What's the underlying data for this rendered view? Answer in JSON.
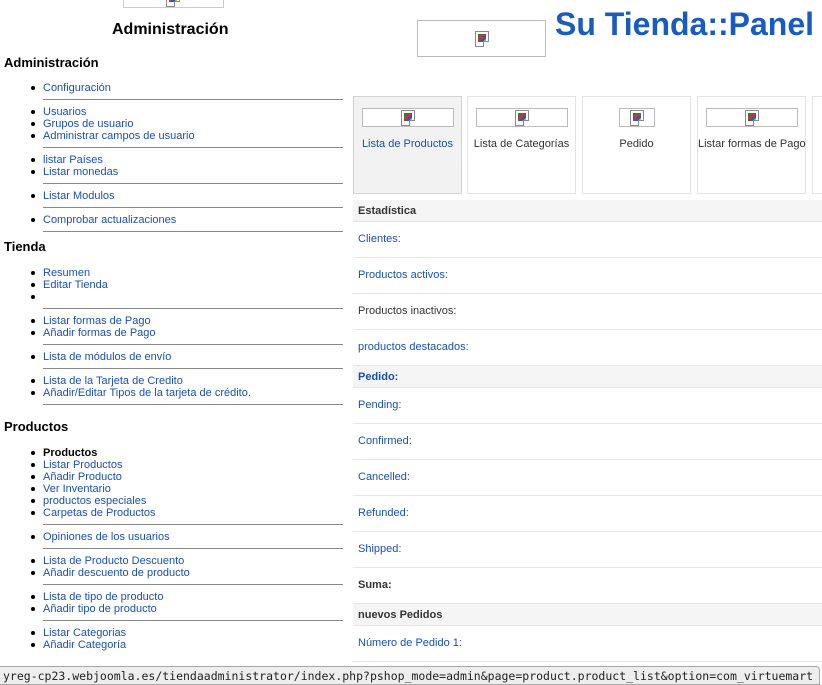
{
  "header": {
    "admin_title": "Administración",
    "panel_title": "Su Tienda::Panel"
  },
  "sidebar": {
    "sections": [
      {
        "title": "Administración"
      },
      {
        "title": "Tienda"
      },
      {
        "title": "Productos"
      }
    ],
    "admin_items": [
      "Configuración",
      "Usuarios",
      "Grupos de usuario",
      "Administrar campos de usuario",
      "listar Países",
      "Listar monedas",
      "Listar Modulos",
      "Comprobar actualizaciones"
    ],
    "shop_items": [
      "Resumen",
      "Editar Tienda",
      "",
      "Listar formas de Pago",
      "Añadir formas de Pago",
      "Lista de módulos de envío",
      "Lista de la Tarjeta de Credito",
      "Añadir/Editar Tipos de la tarjeta de crédito."
    ],
    "product_items": [
      "Productos",
      "Listar Productos",
      "Añadir Producto",
      "Ver Inventario",
      "productos especiales",
      "Carpetas de Productos",
      "Opiniones de los usuarios",
      "Lista de Producto Descuento",
      "Añadir descuento de producto",
      "Lista de tipo de producto",
      "Añadir tipo de producto",
      "Listar Categorias",
      "Añadir Categoría"
    ]
  },
  "tiles": [
    {
      "label": "Lista de Productos",
      "icon": "broken-image-icon"
    },
    {
      "label": "Lista de Categorías",
      "icon": "broken-image-icon"
    },
    {
      "label": "Pedido",
      "icon": "broken-image-icon"
    },
    {
      "label": "Listar formas de Pago",
      "icon": "broken-image-icon"
    }
  ],
  "stats": {
    "statistics_header": "Estadística",
    "rows": [
      "Clientes:",
      "Productos activos:",
      "Productos inactivos:",
      "productos destacados:"
    ],
    "orders_header": "Pedido:",
    "order_rows": [
      "Pending:",
      "Confirmed:",
      "Cancelled:",
      "Refunded:",
      "Shipped:"
    ],
    "sum_label": "Suma:",
    "new_orders_header": "nuevos Pedidos",
    "new_order_row": "Número de Pedido 1:"
  },
  "status_bar": {
    "url": "yreg-cp23.webjoomla.es/tiendaadministrator/index.php?pshop_mode=admin&page=product.product_list&option=com_virtuemart"
  },
  "colors": {
    "link": "#1a4fb5",
    "panel_title": "#1a5bbf"
  }
}
